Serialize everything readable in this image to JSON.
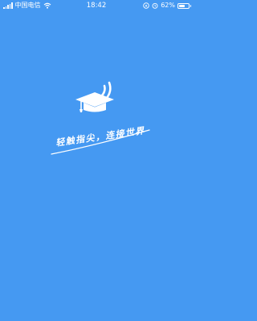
{
  "status_bar": {
    "carrier": "中国电信",
    "time": "18:42",
    "battery_percent": "62%",
    "battery_level": 0.62,
    "icons": [
      "signal-icon",
      "wifi-icon",
      "location-icon",
      "alarm-icon",
      "battery-icon"
    ]
  },
  "splash": {
    "logo_icon": "graduation-cap-wifi-icon",
    "slogan": "轻触指尖，连接世界"
  },
  "colors": {
    "background": "#4599f2",
    "foreground": "#ffffff"
  }
}
